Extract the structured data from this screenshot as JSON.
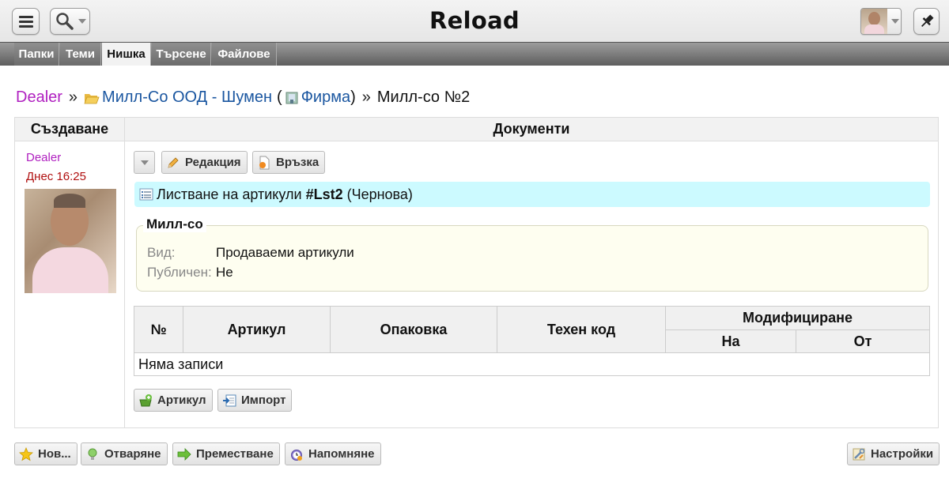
{
  "app": {
    "title": "Reload"
  },
  "tabs": [
    {
      "label": "Папки",
      "active": false
    },
    {
      "label": "Теми",
      "active": false
    },
    {
      "label": "Нишка",
      "active": true
    },
    {
      "label": "Търсене",
      "active": false
    },
    {
      "label": "Файлове",
      "active": false
    }
  ],
  "breadcrumb": {
    "user": "Dealer",
    "separator": "»",
    "folder": "Милл-Со ООД - Шумен",
    "folder_type_open": "(",
    "folder_type": "Фирма",
    "folder_type_close": ")",
    "thread": "Милл-со №2"
  },
  "columns": {
    "created": "Създаване",
    "documents": "Документи"
  },
  "author": {
    "name": "Dealer",
    "time": "Днес 16:25"
  },
  "toolbar": {
    "edit": "Редакция",
    "link": "Връзка"
  },
  "document": {
    "title_prefix": "Листване на артикули",
    "handle": "#Lst2",
    "status": "(Чернова)"
  },
  "info": {
    "legend": "Милл-со",
    "kind_label": "Вид:",
    "kind_value": "Продаваеми артикули",
    "published_label": "Публичен:",
    "published_value": "Не"
  },
  "table": {
    "headers": {
      "num": "№",
      "article": "Артикул",
      "pack": "Опаковка",
      "code": "Техен код",
      "modified": "Модифициране",
      "on": "На",
      "by": "От"
    },
    "empty": "Няма записи"
  },
  "doc_buttons": {
    "article": "Артикул",
    "import": "Импорт"
  },
  "footer": {
    "new": "Нов...",
    "open": "Отваряне",
    "move": "Преместване",
    "remind": "Напомняне",
    "settings": "Настройки"
  },
  "colors": {
    "user": "#b020c0",
    "link": "#1a56a0",
    "doc_highlight": "#ccfaff",
    "fieldset_bg": "#fefef0"
  }
}
